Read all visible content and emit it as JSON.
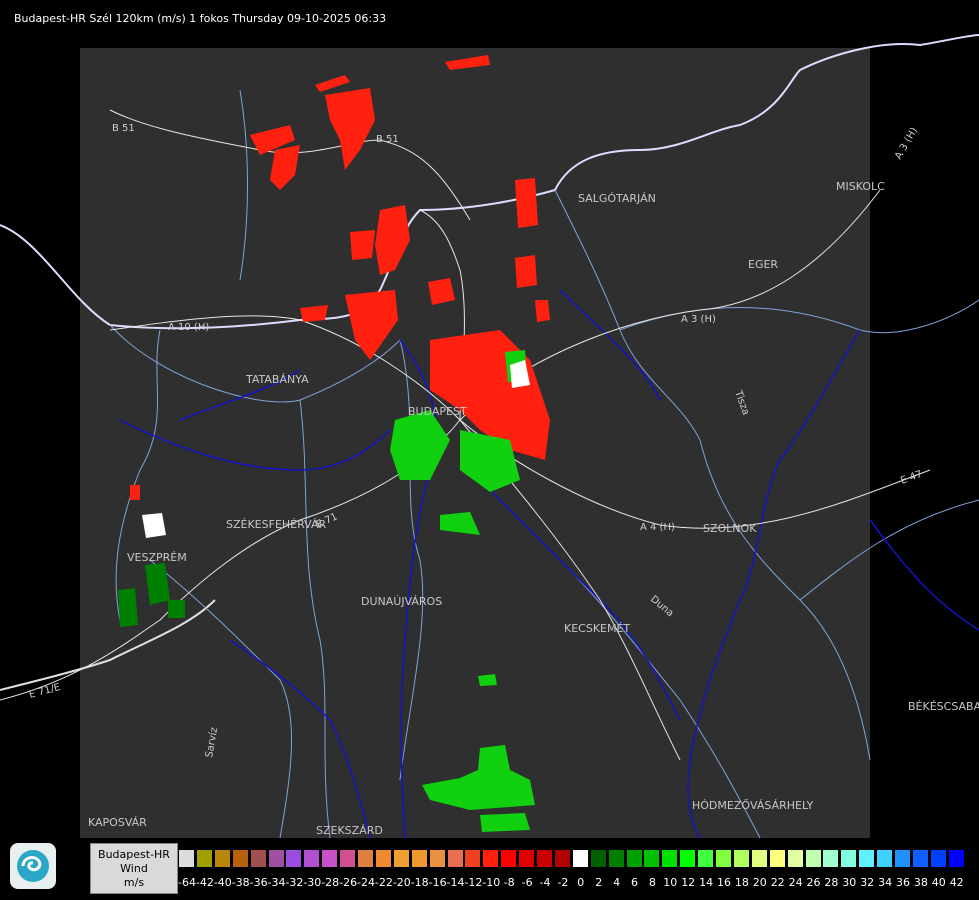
{
  "header": {
    "title": "Budapest-HR Szél 120km (m/s) 1 fokos Thursday 09-10-2025 06:33"
  },
  "cities": [
    "SALGÓTARJÁN",
    "MISKOLC",
    "EGER",
    "TATABÁNYA",
    "BUDAPEST",
    "SZÉKESFEHÉRVÁR",
    "VESZPRÉM",
    "DUNAÚJVÁROS",
    "KECSKEMÉT",
    "SZOLNOK",
    "BÉKÉSCSABA",
    "HÓDMEZŐVÁSÁRHELY",
    "KAPOSVÁR",
    "SZEKSZÁRD"
  ],
  "roads": [
    "B 51",
    "B 51",
    "A 3 (H)",
    "A 3 (H)",
    "A 10 (H)",
    "E 71",
    "E 71/E",
    "E 47",
    "A 4 (H)"
  ],
  "rivers": [
    "Tisza",
    "Duna",
    "Sarvíz"
  ],
  "legend": {
    "line1": "Budapest-HR",
    "line2": "Wind",
    "line3": "m/s",
    "values": [
      "-64",
      "-42",
      "-40",
      "-38",
      "-36",
      "-34",
      "-32",
      "-30",
      "-28",
      "-26",
      "-24",
      "-22",
      "-20",
      "-18",
      "-16",
      "-14",
      "-12",
      "-10",
      "-8",
      "-6",
      "-4",
      "-2",
      "0",
      "2",
      "4",
      "6",
      "8",
      "10",
      "12",
      "14",
      "16",
      "18",
      "20",
      "22",
      "24",
      "26",
      "28",
      "30",
      "32",
      "34",
      "36",
      "38",
      "40",
      "42"
    ],
    "colors": [
      "#dcdcdc",
      "#a0a000",
      "#b8860b",
      "#b8600b",
      "#a05050",
      "#a050a0",
      "#9a4ee0",
      "#b050d0",
      "#c850c8",
      "#d05090",
      "#e08040",
      "#f08a30",
      "#f0a030",
      "#f09830",
      "#e89040",
      "#e87050",
      "#f04020",
      "#ff2010",
      "#ff0000",
      "#e00000",
      "#c80000",
      "#b00000",
      "#ffffff",
      "#006000",
      "#008000",
      "#00a000",
      "#00c000",
      "#00e000",
      "#00ff00",
      "#40ff40",
      "#80ff40",
      "#b0ff60",
      "#e0ff80",
      "#ffff80",
      "#e0ffa0",
      "#c0ffb0",
      "#a0ffd0",
      "#80ffe0",
      "#60f0ff",
      "#40d0ff",
      "#2090ff",
      "#1060ff",
      "#0040ff",
      "#0000ff"
    ]
  }
}
